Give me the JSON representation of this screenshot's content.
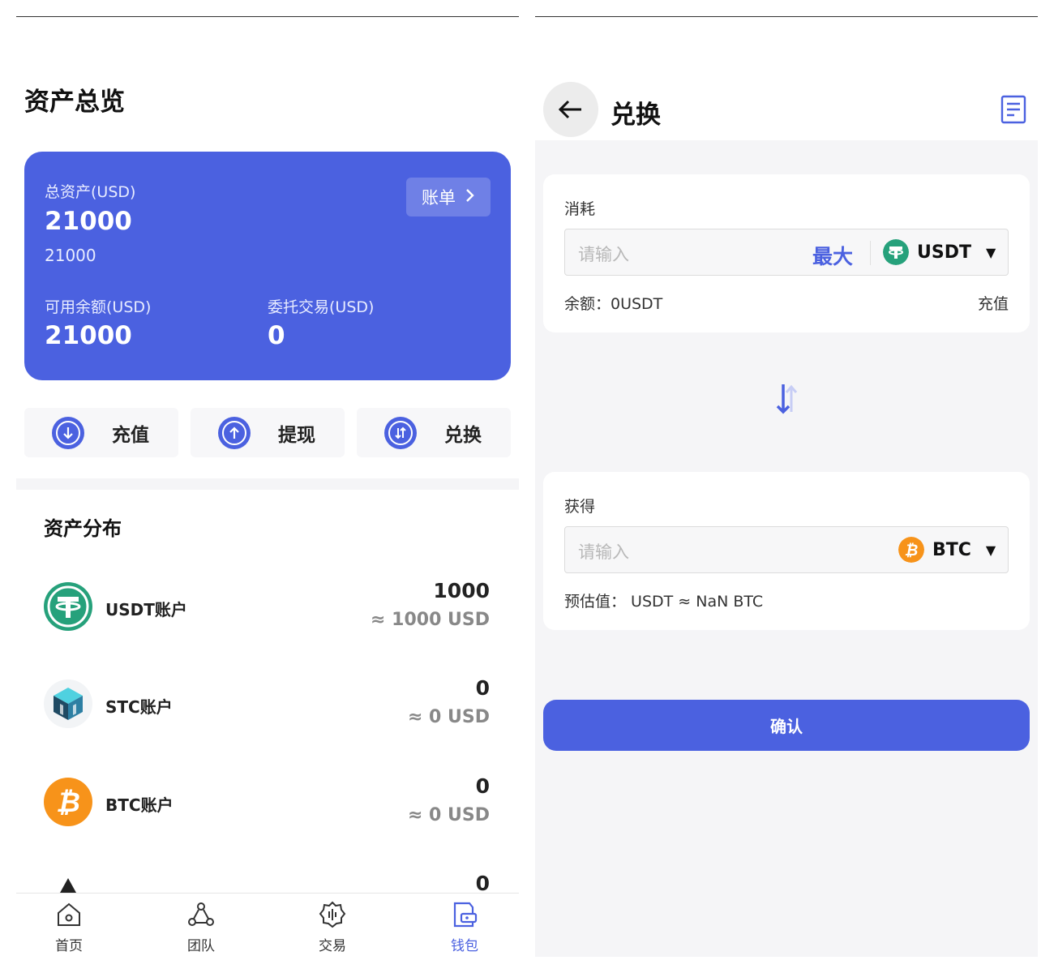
{
  "left": {
    "title": "资产总览",
    "card": {
      "total_label": "总资产(USD)",
      "total_value": "21000",
      "total_sub": "21000",
      "bill_label": "账单",
      "available_label": "可用余额(USD)",
      "available_value": "21000",
      "entrust_label": "委托交易(USD)",
      "entrust_value": "0"
    },
    "actions": [
      {
        "label": "充值",
        "icon": "deposit-icon"
      },
      {
        "label": "提现",
        "icon": "withdraw-icon"
      },
      {
        "label": "兑换",
        "icon": "exchange-icon"
      }
    ],
    "dist_title": "资产分布",
    "assets": [
      {
        "name": "USDT账户",
        "amount": "1000",
        "usd": "≈ 1000 USD",
        "icon": "usdt-coin-icon",
        "color": "#26a17b"
      },
      {
        "name": "STC账户",
        "amount": "0",
        "usd": "≈ 0 USD",
        "icon": "stc-coin-icon",
        "color": "#2b6f8f"
      },
      {
        "name": "BTC账户",
        "amount": "0",
        "usd": "≈ 0 USD",
        "icon": "btc-coin-icon",
        "color": "#f7931a"
      },
      {
        "name": "",
        "amount": "0",
        "usd": "",
        "icon": "eth-coin-icon",
        "color": "#333333"
      }
    ],
    "tabs": [
      {
        "label": "首页",
        "icon": "home-icon",
        "active": false
      },
      {
        "label": "团队",
        "icon": "team-icon",
        "active": false
      },
      {
        "label": "交易",
        "icon": "trade-icon",
        "active": false
      },
      {
        "label": "钱包",
        "icon": "wallet-icon",
        "active": true
      }
    ]
  },
  "right": {
    "title": "兑换",
    "consume": {
      "label": "消耗",
      "placeholder": "请输入",
      "max_label": "最大",
      "currency": "USDT",
      "balance": "余额：0USDT",
      "recharge": "充值"
    },
    "receive": {
      "label": "获得",
      "placeholder": "请输入",
      "currency": "BTC",
      "estimate": "预估值：  USDT ≈ NaN BTC"
    },
    "confirm_label": "确认"
  },
  "colors": {
    "primary": "#4b61e0",
    "usdt": "#26a17b",
    "btc": "#f7931a"
  }
}
